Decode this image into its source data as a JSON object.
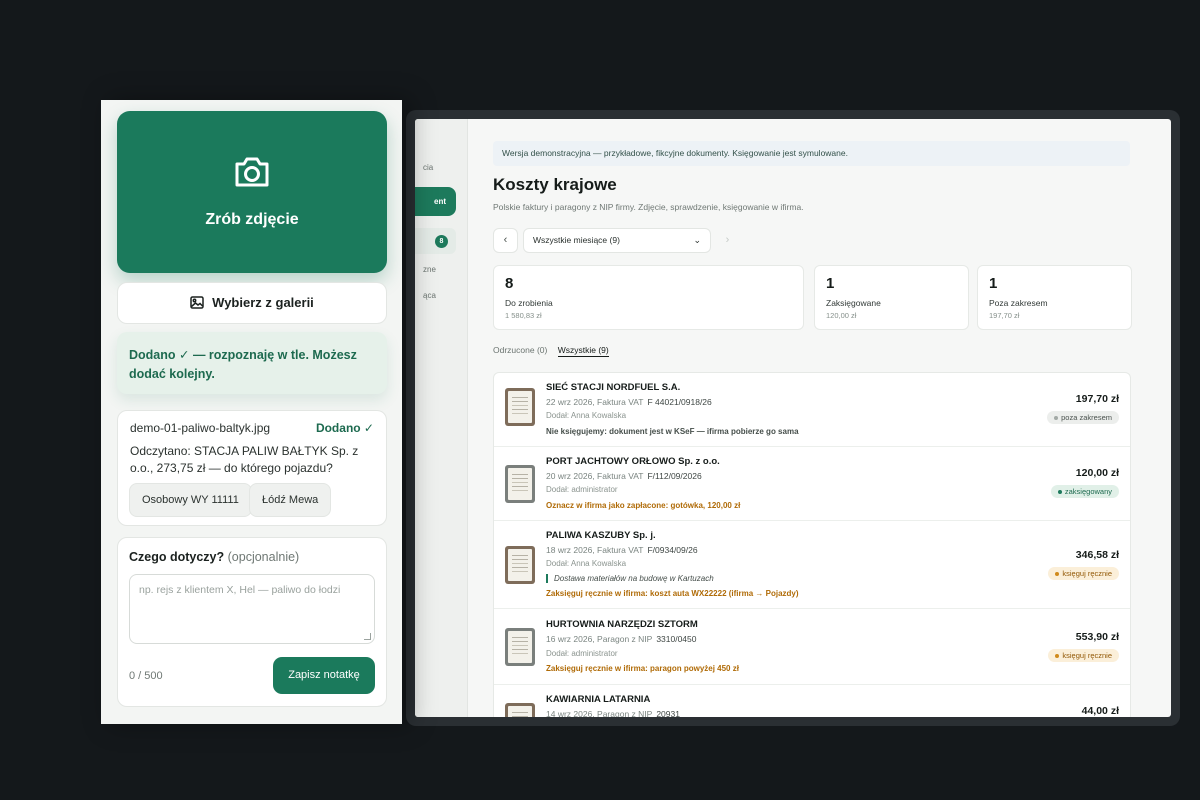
{
  "desktop": {
    "sidebar": {
      "fragment_top": "cia",
      "button_fragment": "ent",
      "badge": "8",
      "fragment_1": "zne",
      "fragment_2": "ąca"
    },
    "banner": "Wersja demonstracyjna — przykładowe, fikcyjne dokumenty. Księgowanie jest symulowane.",
    "title": "Koszty krajowe",
    "subtitle": "Polskie faktury i paragony z NIP firmy. Zdjęcie, sprawdzenie, księgowanie w ifirma.",
    "nav": {
      "prev": "‹",
      "next": "›",
      "month": "Wszystkie miesiące (9)",
      "chevron": "⌄"
    },
    "stats": [
      {
        "num": "8",
        "label": "Do zrobienia",
        "amount": "1 580,83 zł"
      },
      {
        "num": "1",
        "label": "Zaksięgowane",
        "amount": "120,00 zł"
      },
      {
        "num": "1",
        "label": "Poza zakresem",
        "amount": "197,70 zł"
      }
    ],
    "tabs": [
      "Odrzucone (0)",
      "Wszystkie (9)"
    ],
    "rows": [
      {
        "title": "SIEĆ STACJI NORDFUEL S.A.",
        "meta": "22 wrz 2026, Faktura VAT",
        "docno": "F 44021/0918/26",
        "who": "Dodał: Anna Kowalska",
        "note": "Nie księgujemy: dokument jest w KSeF — ifirma pobierze go sama",
        "amount": "197,70 zł",
        "badge": "poza zakresem"
      },
      {
        "title": "PORT JACHTOWY ORŁOWO Sp. z o.o.",
        "meta": "20 wrz 2026, Faktura VAT",
        "docno": "F/112/09/2026",
        "who": "Dodał: administrator",
        "note": "Oznacz w ifirma jako zapłacone: gotówka, 120,00 zł",
        "amount": "120,00 zł",
        "badge": "zaksięgowany"
      },
      {
        "title": "PALIWA KASZUBY Sp. j.",
        "meta": "18 wrz 2026, Faktura VAT",
        "docno": "F/0934/09/26",
        "who": "Dodał: Anna Kowalska",
        "italic": "Dostawa materiałów na budowę w Kartuzach",
        "note": "Zaksięguj ręcznie w ifirma: koszt auta WX22222 (ifirma → Pojazdy)",
        "amount": "346,58 zł",
        "badge": "księguj ręcznie"
      },
      {
        "title": "HURTOWNIA NARZĘDZI SZTORM",
        "meta": "16 wrz 2026, Paragon z NIP",
        "docno": "3310/0450",
        "who": "Dodał: administrator",
        "note": "Zaksięguj ręcznie w ifirma: paragon powyżej 450 zł",
        "amount": "553,90 zł",
        "badge": "księguj ręcznie"
      },
      {
        "title": "KAWIARNIA LATARNIA",
        "meta": "14 wrz 2026, Paragon z NIP",
        "docno": "20931",
        "amount": "44,00 zł"
      }
    ]
  },
  "phone": {
    "camera_label": "Zrób zdjęcie",
    "gallery_label": "Wybierz z galerii",
    "added_message": "Dodano ✓ — rozpoznaję w tle. Możesz dodać kolejny.",
    "file": {
      "name": "demo-01-paliwo-baltyk.jpg",
      "status": "Dodano ✓",
      "read": "Odczytano: STACJA PALIW BAŁTYK Sp. z o.o., 273,75 zł — do którego pojazdu?",
      "vehicles": [
        "Osobowy WY 11111",
        "Łódź Mewa"
      ]
    },
    "note": {
      "title": "Czego dotyczy?",
      "optional": "(opcjonalnie)",
      "placeholder": "np. rejs z klientem X, Hel — paliwo do łodzi",
      "counter": "0 / 500",
      "save": "Zapisz notatkę"
    }
  },
  "colors": {
    "accent": "#1b7a5c",
    "background": "#14181b",
    "warning": "#b06b07"
  }
}
